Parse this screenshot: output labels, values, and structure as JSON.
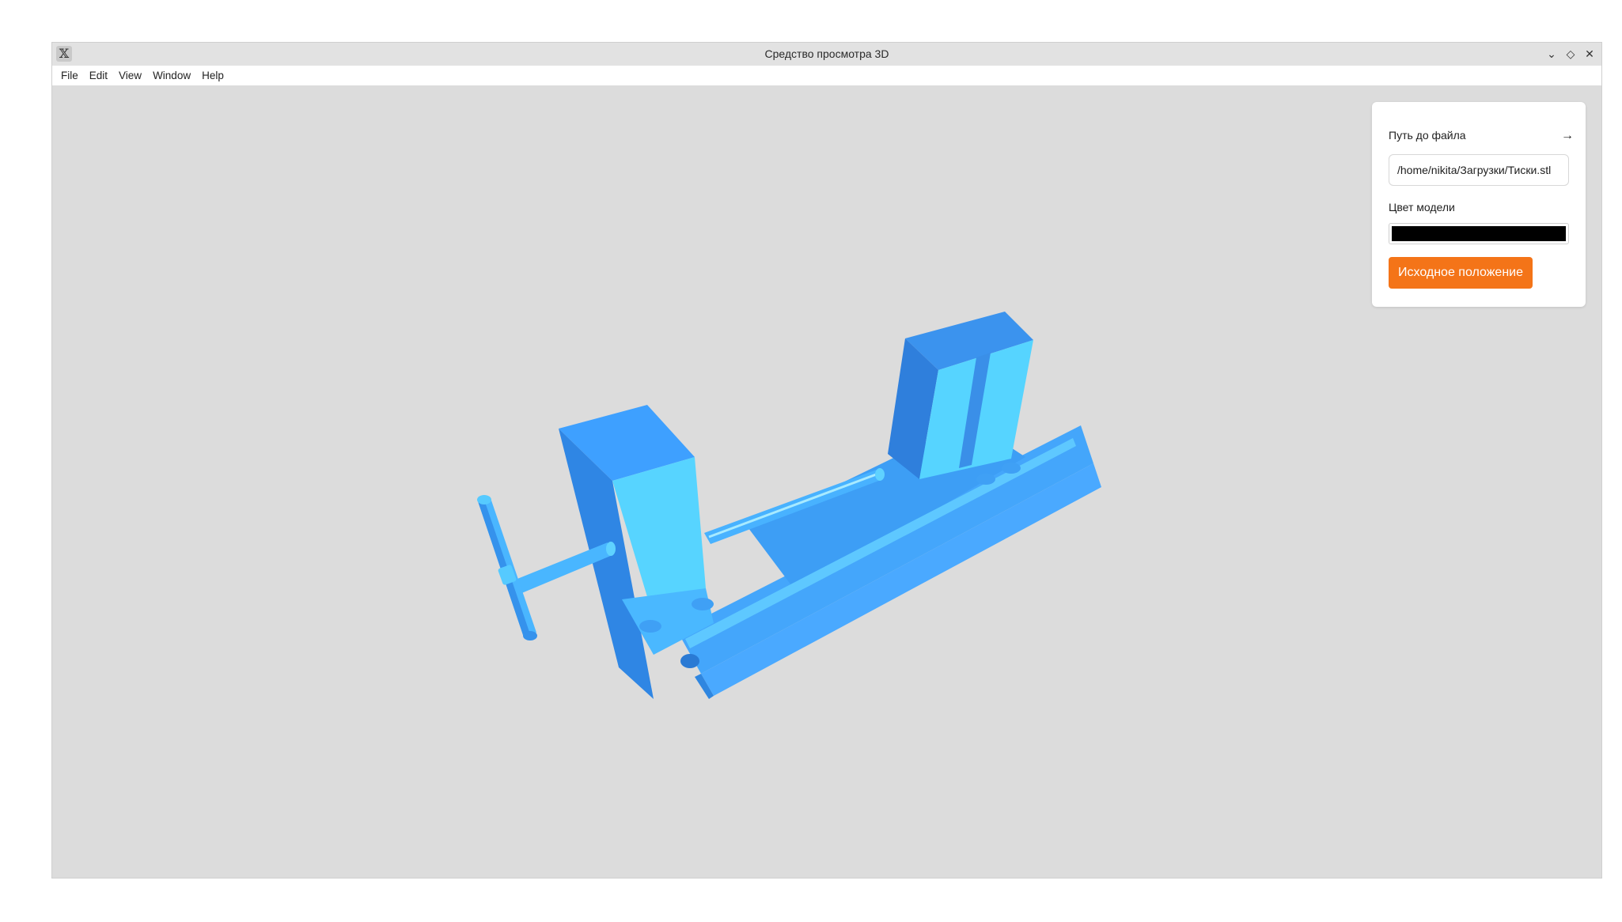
{
  "window": {
    "title": "Средство просмотра 3D",
    "app_icon_glyph": "𝕏",
    "controls": {
      "minimize_glyph": "⌄",
      "maximize_glyph": "◇",
      "close_glyph": "✕"
    }
  },
  "menubar": {
    "items": [
      "File",
      "Edit",
      "View",
      "Window",
      "Help"
    ]
  },
  "panel": {
    "file_path_label": "Путь до файла",
    "open_arrow_glyph": "→",
    "file_path_value": "/home/nikita/Загрузки/Тиски.stl",
    "model_color_label": "Цвет модели",
    "model_color_value": "#000000",
    "reset_button_label": "Исходное положение"
  },
  "viewport": {
    "background_color": "#dcdcdc",
    "model_render_color": "#3fa5ff"
  }
}
